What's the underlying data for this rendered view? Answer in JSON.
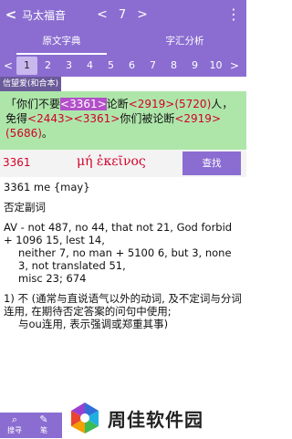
{
  "topbar": {
    "back": "<",
    "book": "马太福音",
    "prev": "<",
    "chapter": "7",
    "next": ">",
    "menu": "⋮"
  },
  "tabs": [
    {
      "label": "原文字典"
    },
    {
      "label": "字汇分析"
    }
  ],
  "verses": {
    "left_arrow": "<",
    "right_arrow": ">",
    "numbers": [
      "1",
      "2",
      "3",
      "4",
      "5",
      "6",
      "7",
      "8",
      "9",
      "10"
    ]
  },
  "version_label": "信望爱(和合本)",
  "verse_text": {
    "p1": "「你们不要",
    "r1": "<3361>",
    "p2": "论断",
    "r2": "<2919>",
    "r3": "(5720)",
    "p3": "人，免得",
    "r4": "<2443>",
    "r5": "<3361>",
    "p4": "你们被论断",
    "r6": "<2919>",
    "r7": "(5686)",
    "p5": "。"
  },
  "strong": {
    "number": "3361",
    "greek": "μή ἐκεῖνος",
    "search_label": "查找"
  },
  "content": {
    "line1": "3361 me {may}",
    "line2": "否定副词",
    "av1": "AV - not 487, no 44, that not 21, God forbid + 1096 15, lest 14,",
    "av2": "neither 7, no man + 5100 6, but 3, none 3, not translated 51,",
    "av3": "misc 23; 674",
    "def1": "1) 不 (通常与直说语气以外的动词, 及不定词与分词连用, 在期待否定答案的问句中使用;",
    "def2": "与ou连用, 表示强调或郑重其事)"
  },
  "bottom": [
    {
      "icon": "search",
      "label": "搜寻"
    },
    {
      "icon": "note",
      "label": "笔"
    }
  ],
  "watermark": {
    "text": "周佳软件园"
  }
}
